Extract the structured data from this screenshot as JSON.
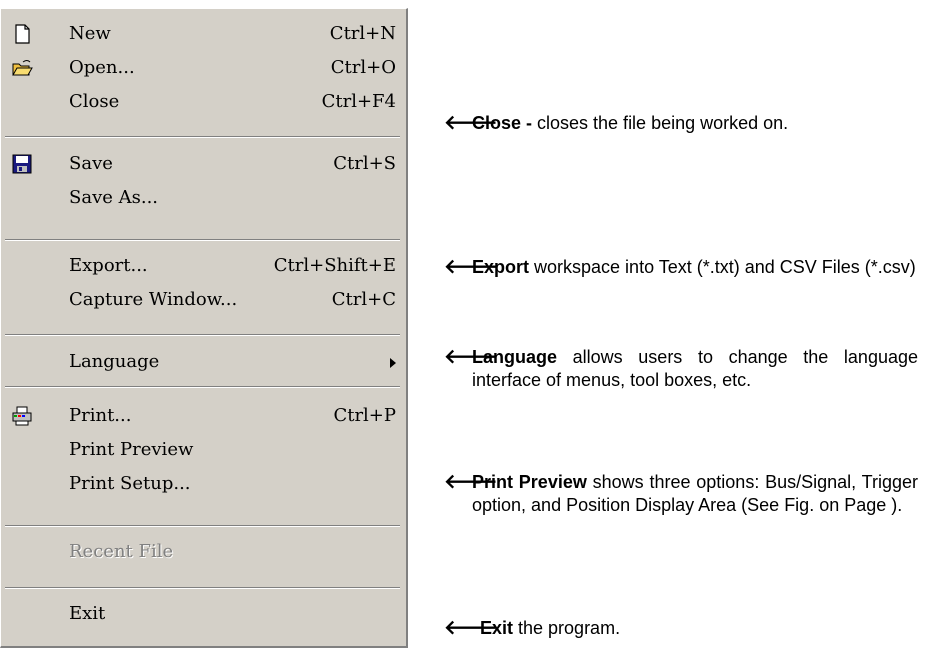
{
  "menu": {
    "items": [
      {
        "icon": "new-file-icon",
        "label": "New",
        "shortcut": "Ctrl+N"
      },
      {
        "icon": "open-folder-icon",
        "label": "Open...",
        "shortcut": "Ctrl+O"
      },
      {
        "icon": "",
        "label": "Close",
        "shortcut": "Ctrl+F4"
      },
      {
        "icon": "save-disk-icon",
        "label": "Save",
        "shortcut": "Ctrl+S"
      },
      {
        "icon": "",
        "label": "Save As...",
        "shortcut": ""
      },
      {
        "icon": "",
        "label": "Export...",
        "shortcut": "Ctrl+Shift+E"
      },
      {
        "icon": "",
        "label": "Capture Window...",
        "shortcut": "Ctrl+C"
      },
      {
        "icon": "submenu-arrow-icon",
        "label": "Language",
        "shortcut": ""
      },
      {
        "icon": "printer-icon",
        "label": "Print...",
        "shortcut": "Ctrl+P"
      },
      {
        "icon": "",
        "label": "Print Preview",
        "shortcut": ""
      },
      {
        "icon": "",
        "label": "Print Setup...",
        "shortcut": ""
      },
      {
        "icon": "",
        "label": "Recent File",
        "shortcut": "",
        "disabled": true
      },
      {
        "icon": "",
        "label": "Exit",
        "shortcut": ""
      }
    ]
  },
  "annotations": {
    "arrow_glyph": "🡐",
    "close": {
      "term": "Close -",
      "text": " closes the file being worked on."
    },
    "export": {
      "term": "Export",
      "text": " workspace into Text (*.txt) and CSV Files (*.csv)"
    },
    "language": {
      "term": "Language",
      "text": " allows users to change the language interface of menus, tool boxes, etc."
    },
    "preview": {
      "term": "Print Preview",
      "text": " shows three options: Bus/Signal, Trigger option, and Position Display Area (See Fig. on Page )."
    },
    "exit": {
      "term": "Exit",
      "text": " the program."
    }
  },
  "colors": {
    "menu_bg": "#d4d0c8",
    "disabled_text": "#808080"
  }
}
